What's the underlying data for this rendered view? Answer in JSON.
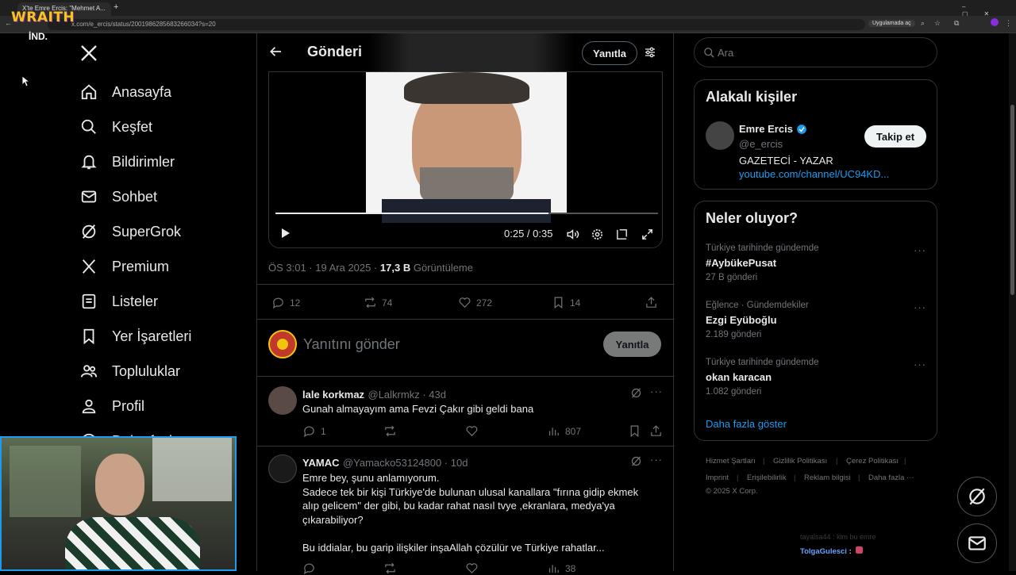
{
  "browser": {
    "tabs": [
      {
        "label": "X'te Emre Ercis: \"Mehmet A..."
      }
    ],
    "url": "x.com/e_ercis/status/2001986285683266034?s=20",
    "open_in_app": "Uygulamada aç"
  },
  "overlay": {
    "brand": "WRAITH",
    "brand_sub": "İND."
  },
  "nav": {
    "items": [
      {
        "label": "Anasayfa",
        "icon": "home-icon"
      },
      {
        "label": "Keşfet",
        "icon": "search-icon"
      },
      {
        "label": "Bildirimler",
        "icon": "bell-icon"
      },
      {
        "label": "Sohbet",
        "icon": "mail-icon"
      },
      {
        "label": "SuperGrok",
        "icon": "grok-icon"
      },
      {
        "label": "Premium",
        "icon": "x-logo-icon"
      },
      {
        "label": "Listeler",
        "icon": "list-icon"
      },
      {
        "label": "Yer İşaretleri",
        "icon": "bookmark-icon"
      },
      {
        "label": "Topluluklar",
        "icon": "people-icon"
      },
      {
        "label": "Profil",
        "icon": "person-icon"
      },
      {
        "label": "Daha fazla",
        "icon": "more-icon"
      }
    ]
  },
  "post": {
    "header_title": "Gönderi",
    "reply_button": "Yanıtla",
    "video": {
      "time": "0:25 / 0:35",
      "progress": 0.714
    },
    "meta_time": "ÖS 3:01 · 19 Ara 2025 · ",
    "views_count": "17,3 B",
    "views_label": " Görüntüleme",
    "stats": {
      "replies": "12",
      "reposts": "74",
      "likes": "272",
      "bookmarks": "14"
    },
    "composer_placeholder": "Yanıtını gönder",
    "composer_button": "Yanıtla"
  },
  "replies": [
    {
      "name": "lale korkmaz",
      "handle": "@Lalkrmkz · 43d",
      "text": "Gunah almayayım ama Fevzi Çakır gibi geldi bana",
      "replies": "1",
      "views": "807"
    },
    {
      "name": "YAMAC",
      "handle": "@Yamacko53124800 · 10d",
      "text_lines": [
        "Emre bey, şunu anlamıyorum.",
        "Sadece tek bir kişi Türkiye'de bulunan ulusal kanallara \"fırına gidip ekmek",
        "alıp gelicem\" der gibi,  bu kadar rahat nasıl tvye ,ekranlara, medya'ya",
        "çıkarabiliyor?",
        "",
        "Bu iddialar, bu garip ilişkiler inşaAllah çözülür ve Türkiye rahatlar..."
      ],
      "views": "38"
    }
  ],
  "right": {
    "search_placeholder": "Ara",
    "related_title": "Alakalı kişiler",
    "person": {
      "name": "Emre Ercis",
      "handle": "@e_ercis",
      "bio": "GAZETECİ - YAZAR",
      "link": "youtube.com/channel/UC94KD...",
      "follow": "Takip et"
    },
    "trends_title": "Neler oluyor?",
    "trends": [
      {
        "meta": "Türkiye tarihinde gündemde",
        "name": "#AybükePusat",
        "count": "27 B gönderi"
      },
      {
        "meta": "Eğlence · Gündemdekiler",
        "name": "Ezgi Eyüboğlu",
        "count": "2.189 gönderi"
      },
      {
        "meta": "Türkiye tarihinde gündemde",
        "name": "okan karacan",
        "count": "1.082 gönderi"
      }
    ],
    "show_more": "Daha fazla göster",
    "footer": [
      "Hizmet Şartları",
      "Gizlilik Politikası",
      "Çerez Politikası",
      "Imprint",
      "Erişilebilirlik",
      "Reklam bilgisi",
      "Daha fazla ···",
      "© 2025 X Corp."
    ]
  },
  "chat_overlay": {
    "faded": "tayalsa44 : kim bu emre",
    "user": "TolgaGulesci",
    "sep": " :"
  },
  "colors": {
    "accent": "#1d9bf0",
    "bg": "#000000",
    "border": "#2f3336",
    "muted": "#71767b"
  }
}
